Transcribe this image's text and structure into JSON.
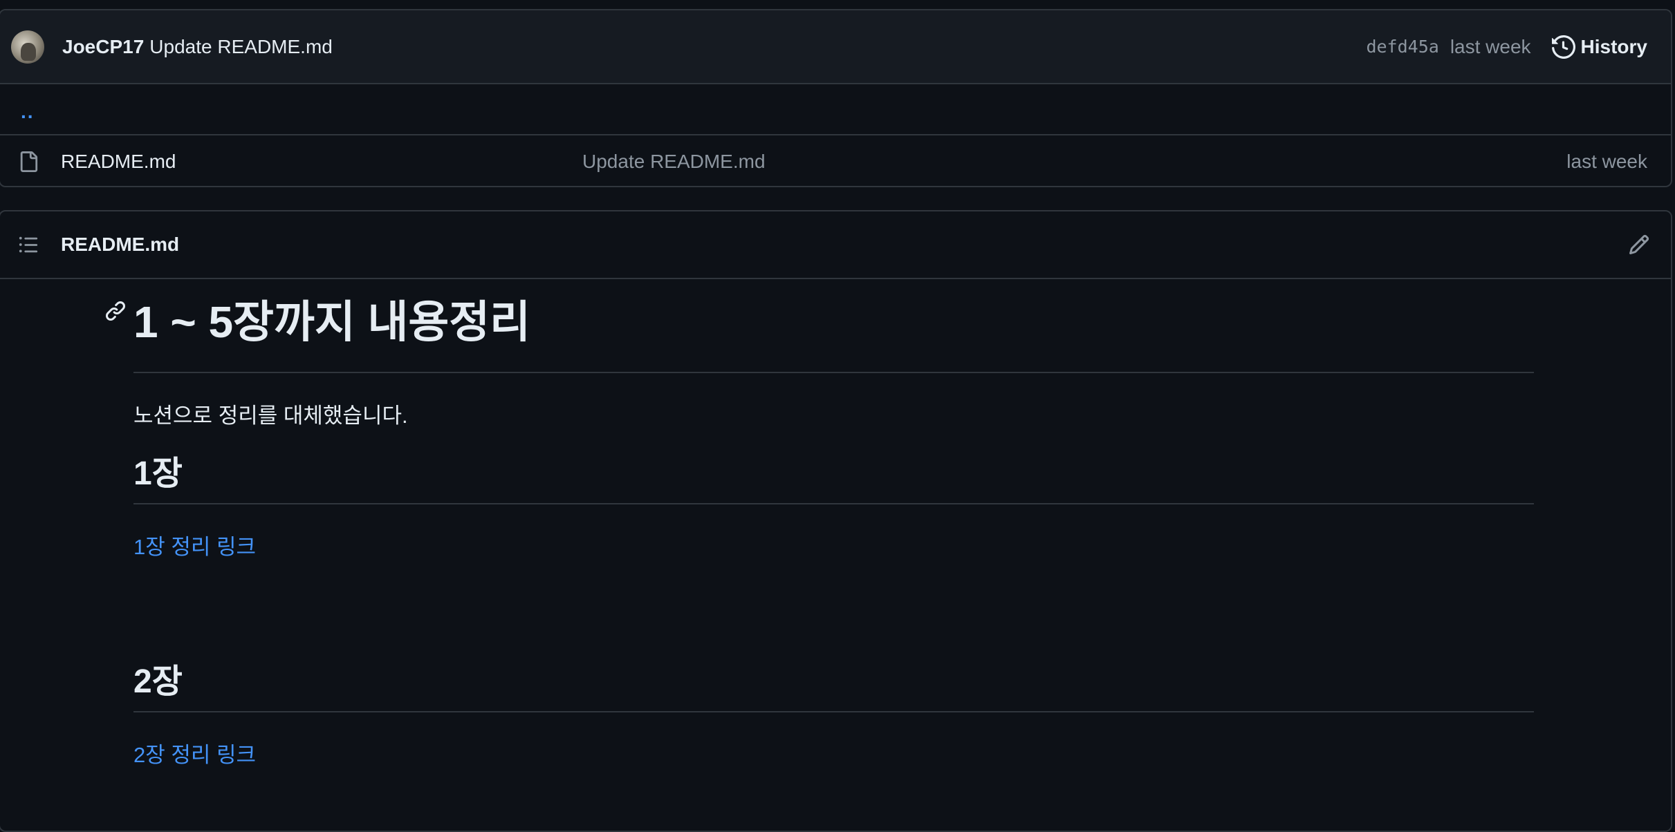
{
  "commit": {
    "author": "JoeCP17",
    "message": "Update README.md",
    "sha": "defd45a",
    "time": "last week",
    "history_label": "History"
  },
  "browser": {
    "parent_label": "..",
    "files": [
      {
        "name": "README.md",
        "commit_message": "Update README.md",
        "time": "last week"
      }
    ]
  },
  "readme": {
    "title": "README.md",
    "h1": "1 ~ 5장까지 내용정리",
    "intro": "노션으로 정리를 대체했습니다.",
    "sections": [
      {
        "heading": "1장",
        "link": "1장 정리 링크"
      },
      {
        "heading": "2장",
        "link": "2장 정리 링크"
      }
    ]
  },
  "colors": {
    "background": "#0d1117",
    "header_bg": "#161b22",
    "border": "#30363d",
    "text": "#e6edf3",
    "muted": "#8d96a0",
    "link": "#4493f8"
  },
  "icons": [
    "avatar",
    "history-icon",
    "file-icon",
    "toc-list-icon",
    "pencil-icon",
    "link-anchor-icon"
  ]
}
